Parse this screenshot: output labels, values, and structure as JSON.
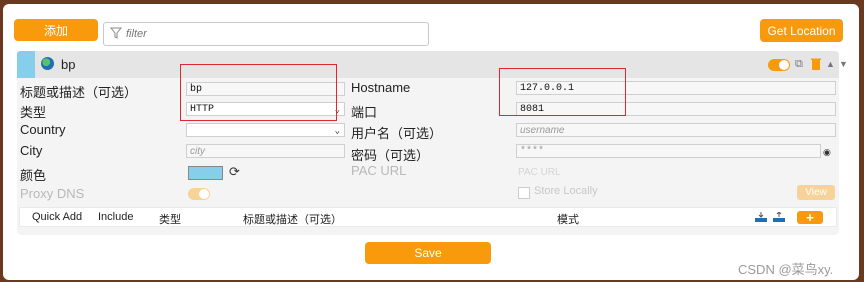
{
  "toolbar": {
    "add_label": "添加",
    "filter_placeholder": "filter",
    "get_location_label": "Get Location"
  },
  "proxy": {
    "title": "bp",
    "header_color": "#87ceeb",
    "icons": [
      "toggle-icon",
      "copy-icon",
      "delete-icon",
      "move-up-icon",
      "move-down-icon"
    ]
  },
  "form": {
    "title_label": "标题或描述（可选）",
    "title_value": "bp",
    "type_label": "类型",
    "type_value": "HTTP",
    "country_label": "Country",
    "country_value": "",
    "city_label": "City",
    "city_placeholder": "city",
    "color_label": "颜色",
    "color_value": "#87ceeb",
    "proxy_dns_label": "Proxy DNS",
    "hostname_label": "Hostname",
    "hostname_value": "127.0.0.1",
    "port_label": "端口",
    "port_value": "8081",
    "username_label": "用户名（可选）",
    "username_placeholder": "username",
    "password_label": "密码（可选）",
    "password_value": "****",
    "pac_url_label": "PAC URL",
    "pac_url_placeholder": "PAC URL",
    "store_locally_label": "Store Locally",
    "view_label": "View"
  },
  "patterns": {
    "quick_add": "Quick Add",
    "include": "Include",
    "type": "类型",
    "title": "标题或描述（可选）",
    "pattern": "模式",
    "plus_label": "+"
  },
  "footer": {
    "save_label": "Save"
  },
  "watermark": "CSDN @菜鸟xy."
}
